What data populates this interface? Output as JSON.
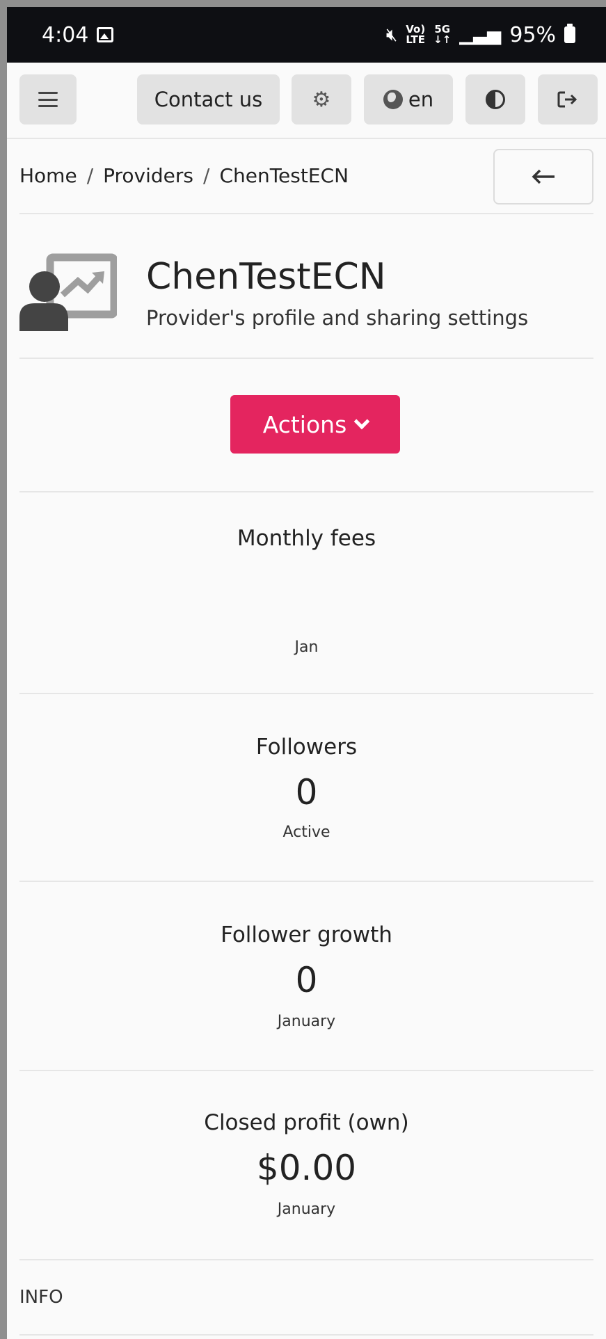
{
  "status_bar": {
    "time": "4:04",
    "net_top": "Vo)",
    "net_bottom": "LTE",
    "gen_top": "5G",
    "gen_bottom": "↓↑",
    "battery": "95%"
  },
  "toolbar": {
    "contact_label": "Contact us",
    "language": "en"
  },
  "breadcrumb": [
    "Home",
    "Providers",
    "ChenTestECN"
  ],
  "header": {
    "title": "ChenTestECN",
    "subtitle": "Provider's profile and sharing settings"
  },
  "actions_label": "Actions",
  "stats": {
    "monthly_fees": {
      "title": "Monthly fees",
      "sub": "Jan"
    },
    "followers": {
      "title": "Followers",
      "value": "0",
      "sub": "Active"
    },
    "follower_growth": {
      "title": "Follower growth",
      "value": "0",
      "sub": "January"
    },
    "closed_profit": {
      "title": "Closed profit (own)",
      "value": "$0.00",
      "sub": "January"
    }
  },
  "info_label": "INFO",
  "colors": {
    "accent": "#e4255f",
    "statusbar": "#0e0f13",
    "button": "#e2e2e2"
  }
}
